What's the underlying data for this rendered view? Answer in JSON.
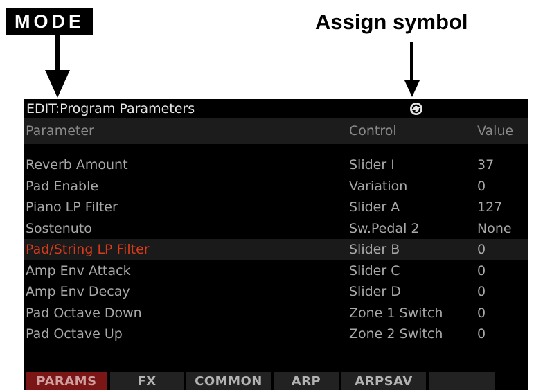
{
  "annotations": {
    "mode_label": "MODE",
    "assign_label": "Assign symbol"
  },
  "screen": {
    "title": "EDIT:Program Parameters",
    "assign_icon": "assign-symbol-icon",
    "columns": {
      "parameter": "Parameter",
      "control": "Control",
      "value": "Value"
    },
    "rows": [
      {
        "parameter": "Reverb Amount",
        "control": "Slider I",
        "value": "37"
      },
      {
        "parameter": "Pad Enable",
        "control": "Variation",
        "value": "0"
      },
      {
        "parameter": "Piano LP Filter",
        "control": "Slider A",
        "value": "127"
      },
      {
        "parameter": "Sostenuto",
        "control": "Sw.Pedal 2",
        "value": "None"
      },
      {
        "parameter": "Pad/String LP Filter",
        "control": "Slider B",
        "value": "0",
        "selected": true
      },
      {
        "parameter": "Amp Env Attack",
        "control": "Slider C",
        "value": "0"
      },
      {
        "parameter": "Amp Env Decay",
        "control": "Slider D",
        "value": "0"
      },
      {
        "parameter": "Pad Octave Down",
        "control": "Zone 1 Switch",
        "value": "0"
      },
      {
        "parameter": "Pad Octave Up",
        "control": "Zone 2 Switch",
        "value": "0"
      }
    ],
    "tabs": [
      {
        "label": "PARAMS",
        "active": true
      },
      {
        "label": "FX"
      },
      {
        "label": "COMMON"
      },
      {
        "label": "ARP"
      },
      {
        "label": "ARPSAV"
      },
      {
        "label": ""
      }
    ],
    "colors": {
      "selected_text": "#d83a1a",
      "active_tab": "#7a1616"
    }
  }
}
